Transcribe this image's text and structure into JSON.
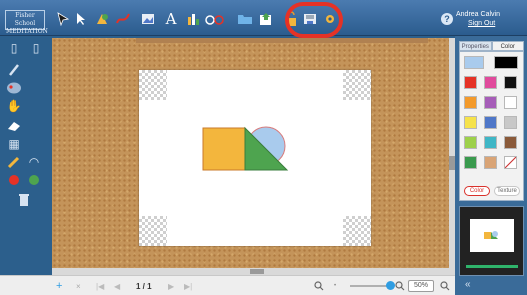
{
  "app": {
    "logo_text": "Fisher School MEDITATION",
    "user_name": "Andrea Calvin",
    "sign_out": "Sign Out",
    "help_label": "?"
  },
  "toolbar": {
    "tools": [
      {
        "name": "select-arrow-icon",
        "glyph": "➤"
      },
      {
        "name": "pointer-icon",
        "glyph": "↖"
      },
      {
        "name": "fill-shape-icon",
        "glyph": "◆"
      },
      {
        "name": "pen-icon",
        "glyph": "✎"
      },
      {
        "name": "image-icon",
        "glyph": "▣"
      },
      {
        "name": "text-icon",
        "glyph": "A"
      },
      {
        "name": "chart-icon",
        "glyph": "▥"
      },
      {
        "name": "glasses-icon",
        "glyph": "∞"
      },
      {
        "name": "folder-icon",
        "glyph": "▬"
      },
      {
        "name": "export-icon",
        "glyph": "⇪"
      },
      {
        "name": "lock-icon",
        "glyph": "🔒"
      },
      {
        "name": "save-icon",
        "glyph": "▤"
      },
      {
        "name": "gear-icon",
        "glyph": "✲"
      }
    ]
  },
  "colors": {
    "accent_blue": "#2c5f8c",
    "highlight_red": "#e53226",
    "shape_orange": "#f3b63d",
    "shape_green": "#4ea44f",
    "shape_blue": "#a9cbed"
  },
  "right_panel": {
    "tabs": [
      "Properties",
      "Color"
    ],
    "active_tab": "Color",
    "color_mode": "Color",
    "texture_label": "Texture",
    "swatches": [
      "#a9cbed",
      "#000000",
      "#e53226",
      "#e04a9c",
      "#e6e6e6",
      "#f39a2b",
      "#a65db8",
      "#ffffff",
      "#f6e24a",
      "#4f77c8",
      "#c8c8c8",
      "#9dd04a",
      "#3fb6c6",
      "#8a5a3a",
      "#3a9a4e",
      "#d9a476",
      "#ffffff"
    ]
  },
  "bottom": {
    "page_indicator": "1 / 1",
    "zoom_value": "50%",
    "add_page": "+",
    "remove_page": "×"
  }
}
